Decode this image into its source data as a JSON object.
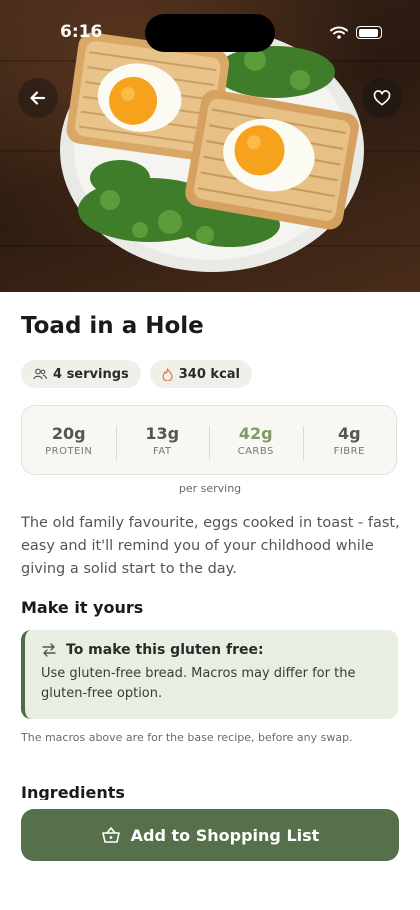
{
  "status_bar": {
    "time": "6:16"
  },
  "recipe": {
    "title": "Toad in a Hole",
    "servings": "4 servings",
    "calories": "340 kcal",
    "macros": [
      {
        "value": "20g",
        "label": "PROTEIN"
      },
      {
        "value": "13g",
        "label": "FAT"
      },
      {
        "value": "42g",
        "label": "CARBS"
      },
      {
        "value": "4g",
        "label": "FIBRE"
      }
    ],
    "per_serving": "per serving",
    "description": "The old family favourite, eggs cooked in toast - fast, easy and it'll remind you of your childhood while giving a solid start to the day."
  },
  "make_it_yours": {
    "heading": "Make it yours",
    "swap_title": "To make this gluten free:",
    "swap_text": "Use gluten-free bread. Macros may differ for the gluten-free option.",
    "note": "The macros above are for the base recipe, before any swap."
  },
  "ingredients": {
    "heading": "Ingredients"
  },
  "cta": {
    "label": "Add to Shopping List"
  },
  "colors": {
    "accent": "#56704b",
    "swap_bg": "#e8efe2",
    "carbs": "#7e9a68"
  },
  "icons": [
    "back-arrow-icon",
    "heart-icon",
    "people-icon",
    "flame-icon",
    "swap-arrows-icon",
    "basket-icon",
    "wifi-icon",
    "battery-icon"
  ]
}
